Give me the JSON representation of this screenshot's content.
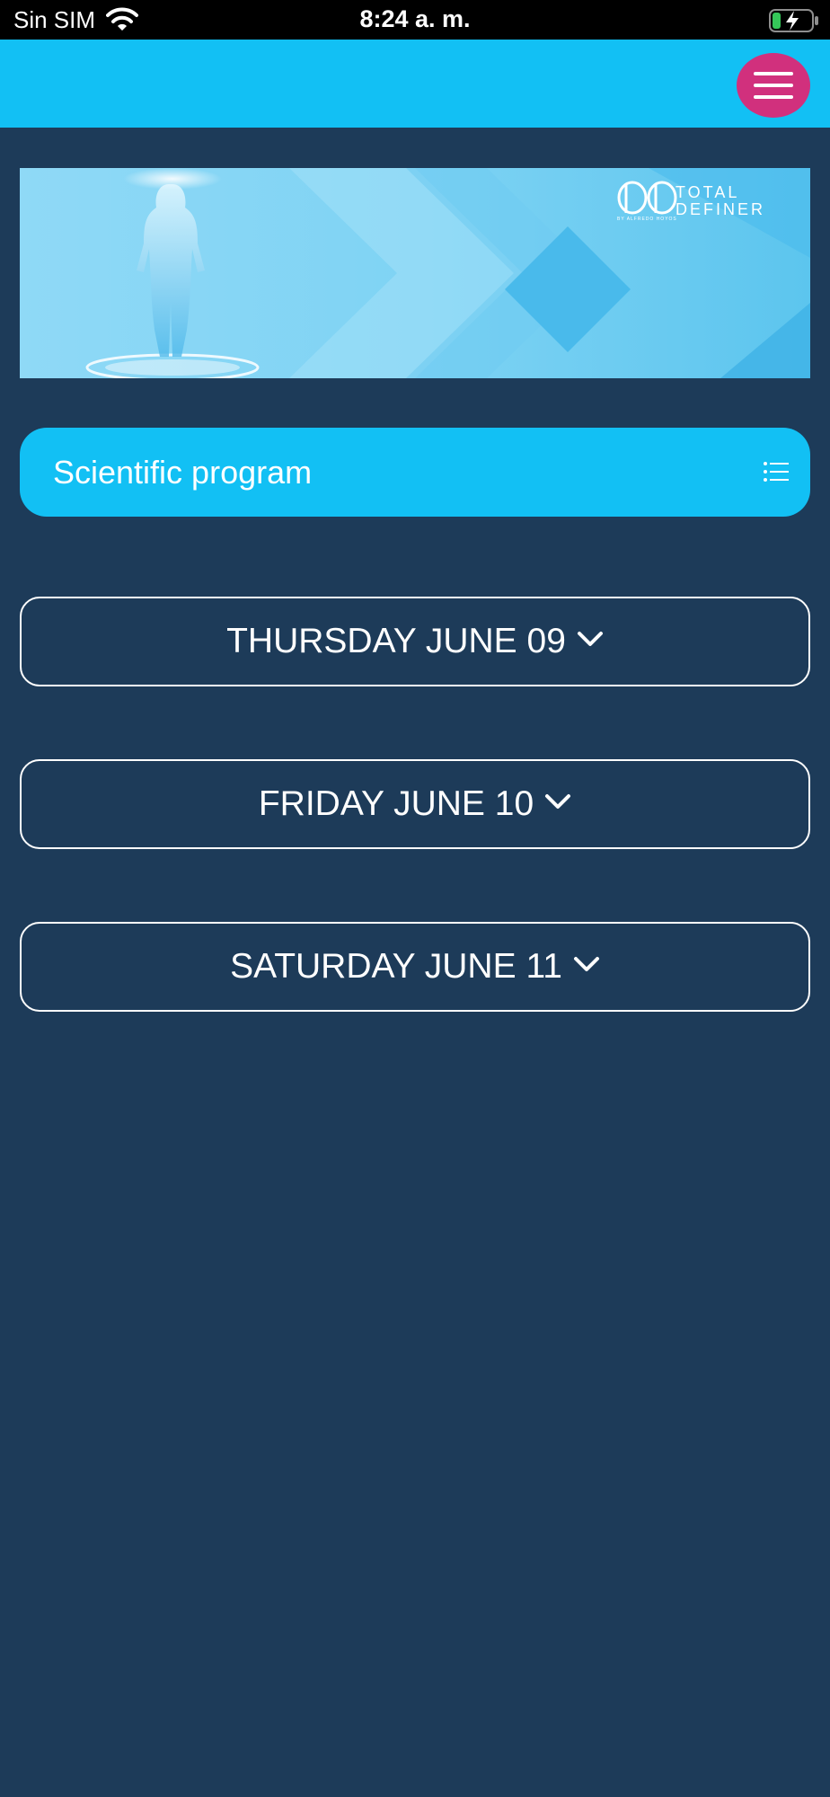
{
  "status_bar": {
    "carrier": "Sin SIM",
    "time": "8:24 a. m.",
    "wifi_icon": "wifi-icon",
    "battery_icon": "battery-charging-icon"
  },
  "header": {
    "menu_icon": "hamburger-menu-icon",
    "menu_color": "#d1307d",
    "background": "#12c0f4"
  },
  "banner": {
    "logo_text_line1": "TOTAL",
    "logo_text_line2": "DEFINER",
    "logo_subtext": "BY ALFREDO HOYOS"
  },
  "program": {
    "label": "Scientific program",
    "icon": "list-icon"
  },
  "days": [
    {
      "label": "THURSDAY JUNE 09",
      "icon": "chevron-down-icon"
    },
    {
      "label": "FRIDAY JUNE 10",
      "icon": "chevron-down-icon"
    },
    {
      "label": "SATURDAY JUNE 11",
      "icon": "chevron-down-icon"
    }
  ],
  "colors": {
    "page_background": "#1d3b59",
    "accent": "#12c0f4"
  }
}
